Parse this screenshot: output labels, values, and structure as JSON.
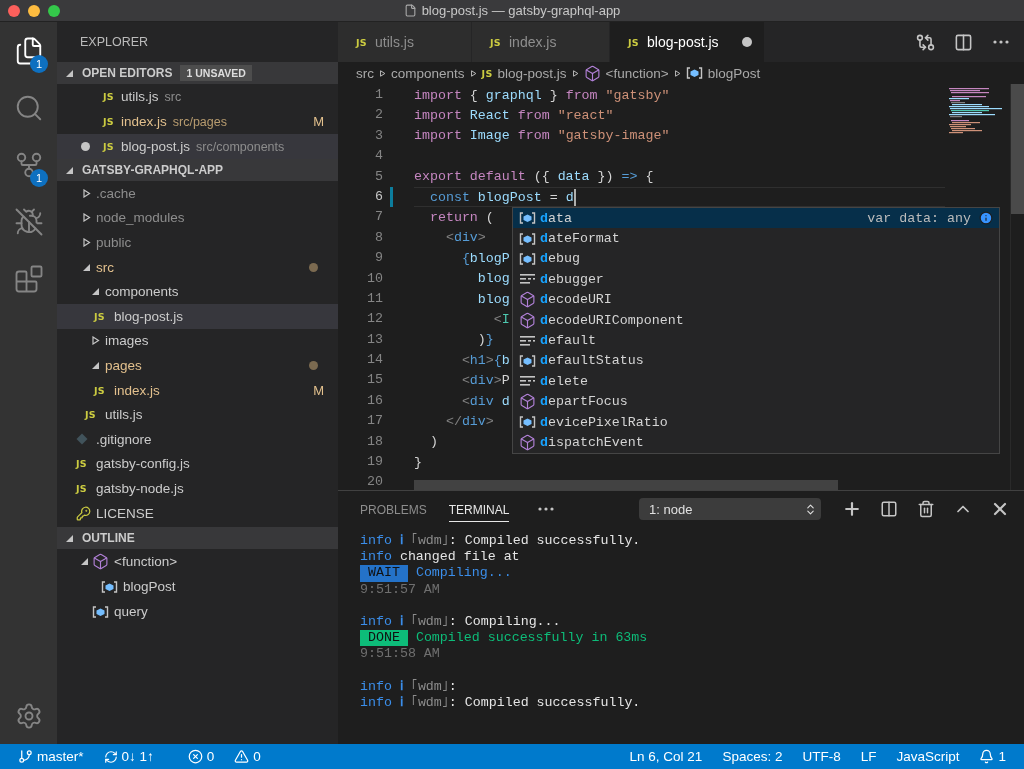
{
  "window": {
    "title": "blog-post.js — gatsby-graphql-app"
  },
  "activity_bar": [
    {
      "kind": "explorer",
      "selected": true,
      "badge": "1"
    },
    {
      "kind": "search",
      "selected": false
    },
    {
      "kind": "source-control",
      "selected": false,
      "badge": "1"
    },
    {
      "kind": "debug",
      "selected": false
    },
    {
      "kind": "extensions",
      "selected": false
    }
  ],
  "explorer": {
    "title": "EXPLORER",
    "open_editors": {
      "title": "OPEN EDITORS",
      "expanded": true,
      "badge": "1 UNSAVED",
      "items": [
        {
          "icon": "JS",
          "name": "utils.js",
          "path": "src",
          "dirty": false,
          "modified": false,
          "selected": false
        },
        {
          "icon": "JS",
          "name": "index.js",
          "path": "src/pages",
          "dirty": false,
          "modified": true,
          "decoration": "M",
          "selected": false
        },
        {
          "icon": "JS",
          "name": "blog-post.js",
          "path": "src/components",
          "dirty": true,
          "modified": false,
          "selected": true
        }
      ]
    },
    "folder": {
      "title": "GATSBY-GRAPHQL-APP",
      "expanded": true,
      "items": [
        {
          "kind": "folder",
          "name": ".cache",
          "expanded": false,
          "ignored": true,
          "modified": false,
          "selected": false
        },
        {
          "kind": "folder",
          "name": "node_modules",
          "expanded": false,
          "ignored": true,
          "modified": false,
          "selected": false
        },
        {
          "kind": "folder",
          "name": "public",
          "expanded": false,
          "ignored": true,
          "modified": false,
          "selected": false
        },
        {
          "kind": "folder",
          "name": "src",
          "expanded": true,
          "ignored": false,
          "modified": true,
          "selected": false,
          "children": [
            {
              "kind": "folder",
              "name": "components",
              "expanded": true,
              "ignored": false,
              "modified": false,
              "selected": false,
              "children": [
                {
                  "kind": "js",
                  "icon": "JS",
                  "name": "blog-post.js",
                  "ignored": false,
                  "modified": false,
                  "selected": true
                }
              ]
            },
            {
              "kind": "folder",
              "name": "images",
              "expanded": false,
              "ignored": false,
              "modified": false,
              "selected": false
            },
            {
              "kind": "folder",
              "name": "pages",
              "expanded": true,
              "ignored": false,
              "modified": true,
              "selected": false,
              "children": [
                {
                  "kind": "js",
                  "icon": "JS",
                  "name": "index.js",
                  "ignored": false,
                  "modified": true,
                  "decoration": "M",
                  "selected": false
                }
              ]
            },
            {
              "kind": "js",
              "icon": "JS",
              "name": "utils.js",
              "ignored": false,
              "modified": false,
              "selected": false
            }
          ]
        },
        {
          "kind": "git",
          "name": ".gitignore",
          "ignored": false,
          "modified": false,
          "selected": false
        },
        {
          "kind": "js",
          "icon": "JS",
          "name": "gatsby-config.js",
          "ignored": false,
          "modified": false,
          "selected": false
        },
        {
          "kind": "js",
          "icon": "JS",
          "name": "gatsby-node.js",
          "ignored": false,
          "modified": false,
          "selected": false
        },
        {
          "kind": "license",
          "name": "LICENSE",
          "ignored": false,
          "modified": false,
          "selected": false
        }
      ]
    },
    "outline": {
      "title": "OUTLINE",
      "expanded": true,
      "items": [
        {
          "kind": "function",
          "name": "<function>",
          "expanded": true,
          "children": [
            {
              "kind": "variable",
              "name": "blogPost"
            }
          ]
        },
        {
          "kind": "variable",
          "name": "query"
        }
      ]
    }
  },
  "tabs": [
    {
      "icon": "JS",
      "label": "utils.js",
      "selected": false,
      "dirty": false
    },
    {
      "icon": "JS",
      "label": "index.js",
      "selected": false,
      "dirty": false
    },
    {
      "icon": "JS",
      "label": "blog-post.js",
      "selected": true,
      "dirty": true
    }
  ],
  "breadcrumbs": [
    {
      "kind": "folder",
      "text": "src"
    },
    {
      "kind": "folder",
      "text": "components"
    },
    {
      "kind": "js",
      "icon": "JS",
      "text": "blog-post.js"
    },
    {
      "kind": "function",
      "text": "<function>"
    },
    {
      "kind": "variable",
      "text": "blogPost"
    }
  ],
  "code": [
    {
      "number": "1",
      "current": false,
      "changed": false,
      "tokens": [
        {
          "kind": "keyword",
          "text": "import"
        },
        {
          "kind": "plain",
          "text": " { "
        },
        {
          "kind": "variable",
          "text": "graphql"
        },
        {
          "kind": "plain",
          "text": " } "
        },
        {
          "kind": "keyword",
          "text": "from "
        },
        {
          "kind": "string",
          "text": "\"gatsby\""
        }
      ]
    },
    {
      "number": "2",
      "current": false,
      "changed": false,
      "tokens": [
        {
          "kind": "keyword",
          "text": "import "
        },
        {
          "kind": "variable",
          "text": "React "
        },
        {
          "kind": "keyword",
          "text": "from "
        },
        {
          "kind": "string",
          "text": "\"react\""
        }
      ]
    },
    {
      "number": "3",
      "current": false,
      "changed": false,
      "tokens": [
        {
          "kind": "keyword",
          "text": "import "
        },
        {
          "kind": "variable",
          "text": "Image "
        },
        {
          "kind": "keyword",
          "text": "from "
        },
        {
          "kind": "string",
          "text": "\"gatsby-image\""
        }
      ]
    },
    {
      "number": "4",
      "current": false,
      "changed": false
    },
    {
      "number": "5",
      "current": false,
      "changed": false,
      "tokens": [
        {
          "kind": "keyword",
          "text": "export default"
        },
        {
          "kind": "plain",
          "text": " ({ "
        },
        {
          "kind": "variable",
          "text": "data"
        },
        {
          "kind": "plain",
          "text": " }) "
        },
        {
          "kind": "storage",
          "text": "=>"
        },
        {
          "kind": "plain",
          "text": " {"
        }
      ]
    },
    {
      "number": "6",
      "current": true,
      "changed": true,
      "tokens": [
        {
          "kind": "storage",
          "text": "  const "
        },
        {
          "kind": "variable",
          "text": "blogPost"
        },
        {
          "kind": "plain",
          "text": " = "
        },
        {
          "kind": "variable",
          "text": "d"
        }
      ]
    },
    {
      "number": "7",
      "current": false,
      "changed": false,
      "tokens": [
        {
          "kind": "keyword",
          "text": "  return"
        },
        {
          "kind": "plain",
          "text": " ("
        }
      ]
    },
    {
      "number": "8",
      "current": false,
      "changed": false,
      "tokens": [
        {
          "kind": "tag_punct",
          "text": "    <"
        },
        {
          "kind": "tag",
          "text": "div"
        },
        {
          "kind": "tag_punct",
          "text": ">"
        }
      ]
    },
    {
      "number": "9",
      "current": false,
      "changed": false,
      "tokens": [
        {
          "kind": "brace",
          "text": "      {"
        },
        {
          "kind": "variable",
          "text": "blogP"
        }
      ]
    },
    {
      "number": "10",
      "current": false,
      "changed": false,
      "tokens": [
        {
          "kind": "variable",
          "text": "        blog"
        }
      ]
    },
    {
      "number": "11",
      "current": false,
      "changed": false,
      "tokens": [
        {
          "kind": "variable",
          "text": "        blog"
        }
      ]
    },
    {
      "number": "12",
      "current": false,
      "changed": false,
      "tokens": [
        {
          "kind": "tag_punct",
          "text": "          <"
        },
        {
          "kind": "component",
          "text": "I"
        }
      ]
    },
    {
      "number": "13",
      "current": false,
      "changed": false,
      "tokens": [
        {
          "kind": "plain",
          "text": "        )"
        },
        {
          "kind": "brace",
          "text": "}"
        }
      ]
    },
    {
      "number": "14",
      "current": false,
      "changed": false,
      "tokens": [
        {
          "kind": "tag_punct",
          "text": "      <"
        },
        {
          "kind": "tag",
          "text": "h1"
        },
        {
          "kind": "tag_punct",
          "text": ">"
        },
        {
          "kind": "brace",
          "text": "{"
        },
        {
          "kind": "variable",
          "text": "b"
        }
      ]
    },
    {
      "number": "15",
      "current": false,
      "changed": false,
      "tokens": [
        {
          "kind": "tag_punct",
          "text": "      <"
        },
        {
          "kind": "tag",
          "text": "div"
        },
        {
          "kind": "tag_punct",
          "text": ">"
        },
        {
          "kind": "plain",
          "text": "P"
        }
      ]
    },
    {
      "number": "16",
      "current": false,
      "changed": false,
      "tokens": [
        {
          "kind": "tag_punct",
          "text": "      <"
        },
        {
          "kind": "tag",
          "text": "div"
        },
        {
          "kind": "variable",
          "text": " d"
        }
      ]
    },
    {
      "number": "17",
      "current": false,
      "changed": false,
      "tokens": [
        {
          "kind": "tag_punct",
          "text": "    </"
        },
        {
          "kind": "tag",
          "text": "div"
        },
        {
          "kind": "tag_punct",
          "text": ">"
        }
      ]
    },
    {
      "number": "18",
      "current": false,
      "changed": false,
      "tokens": [
        {
          "kind": "plain",
          "text": "  )"
        }
      ]
    },
    {
      "number": "19",
      "current": false,
      "changed": false,
      "tokens": [
        {
          "kind": "plain",
          "text": "}"
        }
      ]
    },
    {
      "number": "20",
      "current": false,
      "changed": false
    }
  ],
  "suggestions": [
    {
      "kind": "variable",
      "label": "**d**ata",
      "detail": "var data: any",
      "selected": true
    },
    {
      "kind": "variable",
      "label": "**d**ateFormat",
      "selected": false
    },
    {
      "kind": "variable",
      "label": "**d**ebug",
      "selected": false
    },
    {
      "kind": "keyword",
      "label": "**d**ebugger",
      "selected": false
    },
    {
      "kind": "method",
      "label": "**d**ecodeURI",
      "selected": false
    },
    {
      "kind": "method",
      "label": "**d**ecodeURIComponent",
      "selected": false
    },
    {
      "kind": "keyword",
      "label": "**d**efault",
      "selected": false
    },
    {
      "kind": "variable",
      "label": "**d**efaultStatus",
      "selected": false
    },
    {
      "kind": "keyword",
      "label": "**d**elete",
      "selected": false
    },
    {
      "kind": "method",
      "label": "**d**epartFocus",
      "selected": false
    },
    {
      "kind": "variable",
      "label": "**d**evicePixelRatio",
      "selected": false
    },
    {
      "kind": "method",
      "label": "**d**ispatchEvent",
      "selected": false
    }
  ],
  "panel": {
    "tabs": [
      {
        "label": "PROBLEMS",
        "selected": false
      },
      {
        "label": "TERMINAL",
        "selected": true
      }
    ],
    "terminal_select": "1: node",
    "terminal": [
      [
        [
          {
            "kind": "info",
            "text": "info "
          },
          {
            "kind": "icon",
            "text": "ℹ "
          },
          {
            "kind": "dim",
            "text": "｢wdm｣"
          },
          {
            "kind": "text",
            "text": ": Compiled successfully."
          }
        ],
        [
          {
            "kind": "info",
            "text": "info"
          },
          {
            "kind": "text",
            "text": " changed file at"
          }
        ],
        [
          {
            "kind": "badge_wait",
            "text": "WAIT"
          },
          {
            "kind": "progress",
            "text": " Compiling..."
          }
        ],
        [
          {
            "kind": "time",
            "text": "9:51:57 AM"
          }
        ]
      ],
      [
        [
          {
            "kind": "info",
            "text": "info "
          },
          {
            "kind": "icon",
            "text": "ℹ "
          },
          {
            "kind": "dim",
            "text": "｢wdm｣"
          },
          {
            "kind": "text",
            "text": ": Compiling..."
          }
        ],
        [
          {
            "kind": "badge_done",
            "text": "DONE"
          },
          {
            "kind": "success",
            "text": " Compiled successfully in 63ms"
          }
        ],
        [
          {
            "kind": "time",
            "text": "9:51:58 AM"
          }
        ]
      ],
      [
        [
          {
            "kind": "info",
            "text": "info "
          },
          {
            "kind": "icon",
            "text": "ℹ "
          },
          {
            "kind": "dim",
            "text": "｢wdm｣"
          },
          {
            "kind": "text",
            "text": ":"
          }
        ],
        [
          {
            "kind": "info",
            "text": "info "
          },
          {
            "kind": "icon",
            "text": "ℹ "
          },
          {
            "kind": "dim",
            "text": "｢wdm｣"
          },
          {
            "kind": "text",
            "text": ": Compiled successfully."
          }
        ]
      ]
    ]
  },
  "status_bar": {
    "left": [
      {
        "kind": "branch",
        "text": "master*"
      },
      {
        "kind": "sync",
        "text": "0↓ 1↑"
      },
      {
        "kind": "errors",
        "text": "0"
      },
      {
        "kind": "warnings",
        "text": "0"
      }
    ],
    "right": [
      {
        "kind": "position",
        "text": "Ln 6, Col 21"
      },
      {
        "kind": "indent",
        "text": "Spaces: 2"
      },
      {
        "kind": "encoding",
        "text": "UTF-8"
      },
      {
        "kind": "eol",
        "text": "LF"
      },
      {
        "kind": "language",
        "text": "JavaScript"
      },
      {
        "kind": "notifications",
        "text": "1"
      }
    ]
  }
}
